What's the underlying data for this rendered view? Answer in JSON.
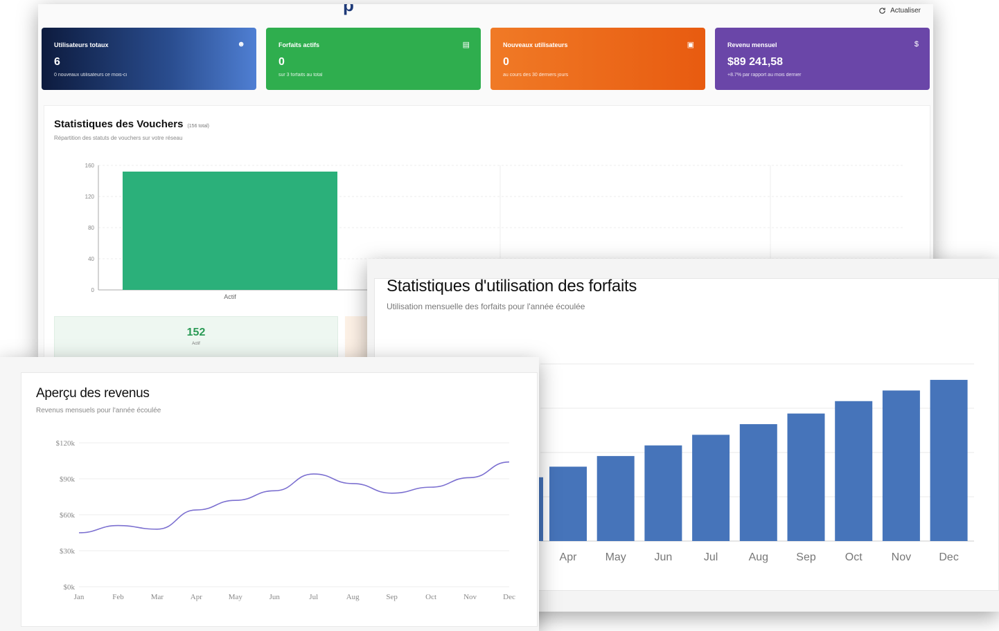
{
  "header": {
    "refresh_label": "Actualiser",
    "partial_title": "p"
  },
  "cards": {
    "users": {
      "title": "Utilisateurs totaux",
      "value": "6",
      "sub": "0 nouveaux utilisateurs ce mois-ci",
      "icon": "user-icon"
    },
    "plans": {
      "title": "Forfaits actifs",
      "value": "0",
      "sub": "sur 3 forfaits au total",
      "icon": "calendar-icon"
    },
    "new_users": {
      "title": "Nouveaux utilisateurs",
      "value": "0",
      "sub": "au cours des 30 derniers jours",
      "icon": "gift-icon"
    },
    "revenue": {
      "title": "Revenu mensuel",
      "value": "$89 241,58",
      "sub": "+8.7% par rapport au mois dernier",
      "icon": "dollar-icon"
    }
  },
  "vouchers": {
    "title": "Statistiques des Vouchers",
    "total": "(156 total)",
    "subtitle": "Répartition des statuts de vouchers sur votre réseau",
    "count_value": "152",
    "count_label": "Actif"
  },
  "plans": {
    "title": "Statistiques d'utilisation des forfaits",
    "subtitle": "Utilisation mensuelle des forfaits pour l'année écoulée"
  },
  "revenue": {
    "title": "Aperçu des revenus",
    "subtitle": "Revenus mensuels pour l'année écoulée"
  },
  "chart_data": [
    {
      "type": "bar",
      "id": "vouchers",
      "categories": [
        "Actif"
      ],
      "values": [
        152
      ],
      "ylim": [
        0,
        160
      ],
      "yticks": [
        0,
        40,
        80,
        120,
        160
      ],
      "color": "#2bb07a"
    },
    {
      "type": "bar",
      "id": "plans",
      "categories": [
        "Apr",
        "May",
        "Jun",
        "Jul",
        "Aug",
        "Sep",
        "Oct",
        "Nov",
        "Dec"
      ],
      "values": [
        42,
        48,
        54,
        60,
        66,
        72,
        79,
        85,
        91
      ],
      "ylim": [
        0,
        100
      ],
      "color": "#4674ba"
    },
    {
      "type": "line",
      "id": "revenue",
      "categories": [
        "Jan",
        "Feb",
        "Mar",
        "Apr",
        "May",
        "Jun",
        "Jul",
        "Aug",
        "Sep",
        "Oct",
        "Nov",
        "Dec"
      ],
      "values": [
        45000,
        51000,
        48000,
        64000,
        72000,
        80000,
        94000,
        86000,
        78000,
        83000,
        91000,
        104000
      ],
      "ylim": [
        0,
        120000
      ],
      "yticks": [
        "$0k",
        "$30k",
        "$60k",
        "$90k",
        "$120k"
      ],
      "color": "#7b6fd0"
    }
  ]
}
